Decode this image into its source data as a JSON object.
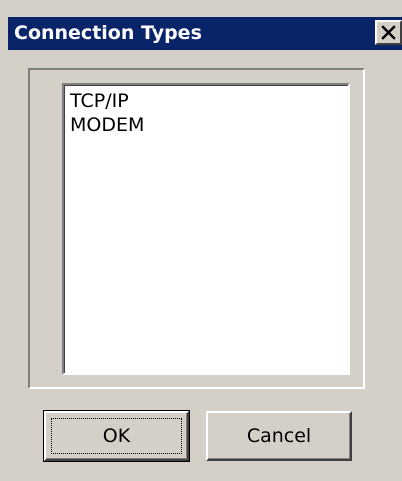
{
  "window": {
    "title": "Connection Types",
    "close_icon": "close-x-icon"
  },
  "list": {
    "items": [
      "TCP/IP",
      "MODEM"
    ]
  },
  "buttons": {
    "ok_label": "OK",
    "cancel_label": "Cancel"
  },
  "colors": {
    "title_bar": "#0a246a",
    "dialog_face": "#d4d0c8",
    "list_background": "#ffffff"
  }
}
